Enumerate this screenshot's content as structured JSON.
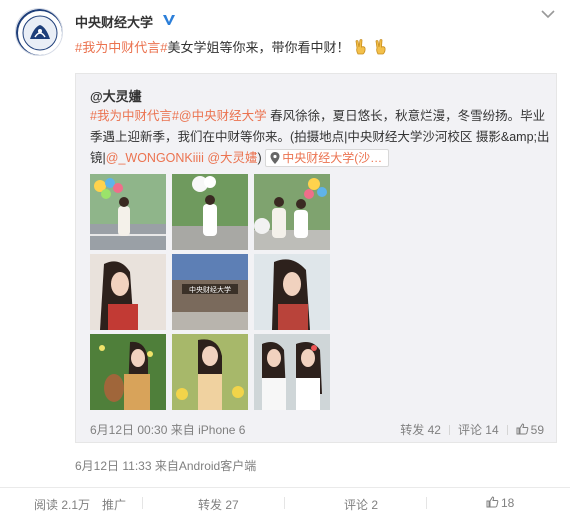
{
  "author": {
    "name": "中央财经大学",
    "avatar_icon": "university-seal-avatar",
    "verified_icon": "verified-v-icon"
  },
  "post": {
    "topic": "#我为中财代言#",
    "text": "美女学姐等你来，带你看中财！",
    "emoji": [
      "victory-hand-emoji",
      "victory-hand-emoji"
    ],
    "time": "6月12日 11:33",
    "from_label": "来自",
    "source": "Android客户端"
  },
  "repost": {
    "author": "@大灵嫿",
    "topic1": "#我为中财代言#",
    "mention1": "@中央财经大学",
    "text1": " 春风徐徐，夏日悠长，秋意烂漫，冬雪纷扬。毕业季遇上迎新季，我们在中财等你来。(拍摄地点|中央财经大学沙河校区 摄影&amp;出镜|",
    "mention2": "@_WONGONKiiii",
    "mention3": " @大灵嫿",
    "text2": ")",
    "location_label": "中央财经大学(沙…",
    "time": "6月12日 00:30",
    "from_label": "来自",
    "source": "iPhone 6",
    "repost_count": "转发 42",
    "comment_count": "评论 14",
    "like_count": "59"
  },
  "footer": {
    "reads": "阅读 2.1万",
    "promote": "推广",
    "repost": "转发 27",
    "comment": "评论 2",
    "like": "18"
  },
  "colors": {
    "accent": "#eb7350",
    "verified": "#2c7fd9",
    "meta": "#808080"
  }
}
